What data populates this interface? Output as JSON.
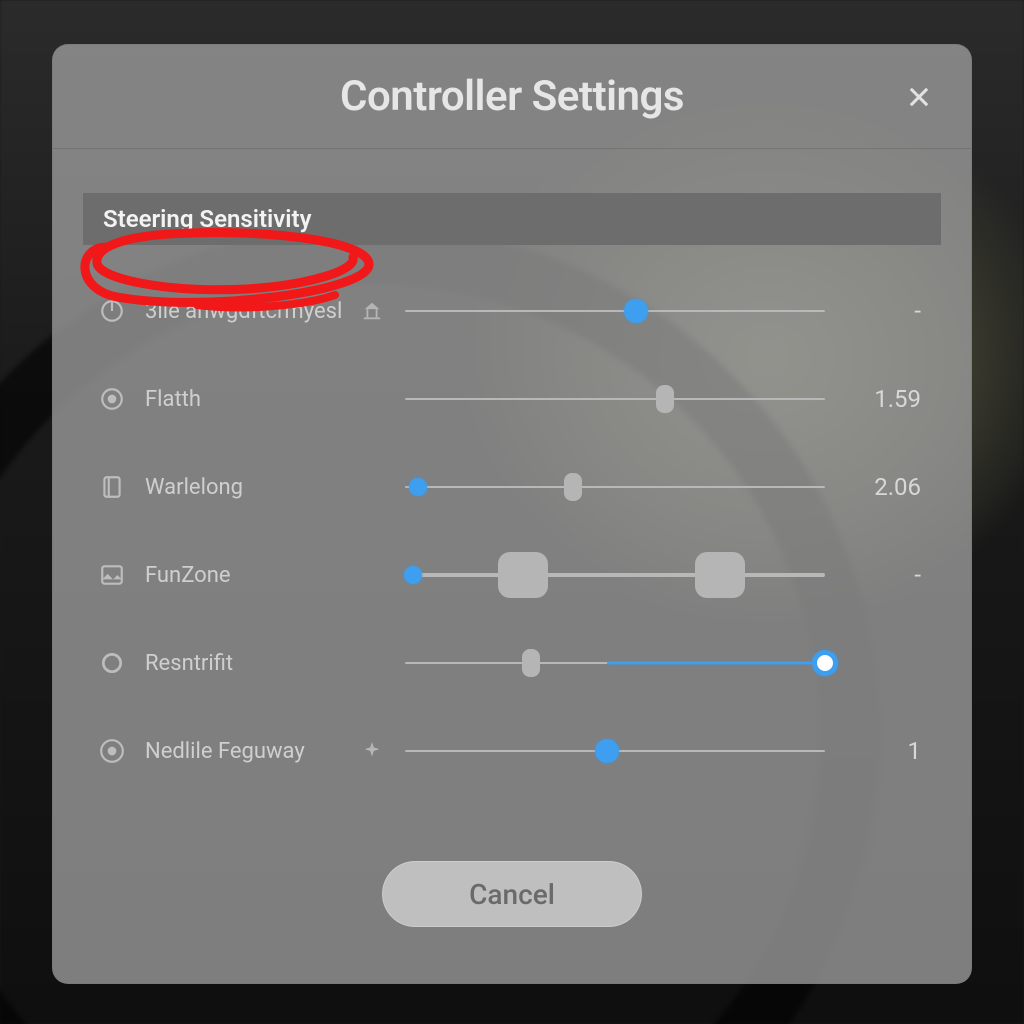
{
  "dialog": {
    "title": "Controller Settings",
    "section_label": "Steering Sensitivity",
    "cancel_label": "Cancel"
  },
  "rows": [
    {
      "label": "3ile anwgdftcrmyesl",
      "value": "-",
      "thumb_pct": 55
    },
    {
      "label": "Flatth",
      "value": "1.59",
      "thumb_pct": 62
    },
    {
      "label": "Warlelong",
      "value": "2.06",
      "thumb_pct": 3
    },
    {
      "label": "FunZone",
      "value": "-",
      "thumb_pct": 2
    },
    {
      "label": "Resntrifit",
      "value": "",
      "thumb_pct": 100
    },
    {
      "label": "Nedlile Feguway",
      "value": "1",
      "thumb_pct": 48
    }
  ]
}
